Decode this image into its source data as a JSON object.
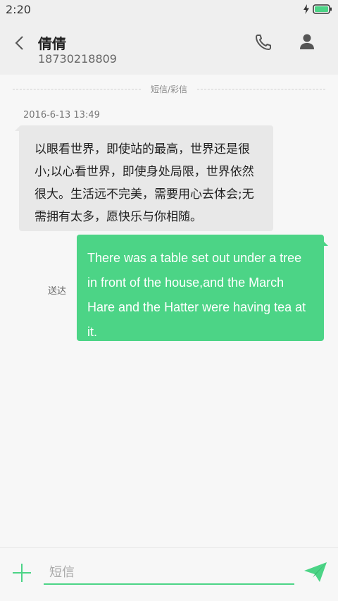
{
  "status_bar": {
    "time": "2:20"
  },
  "header": {
    "name": "倩倩",
    "number": "18730218809"
  },
  "thread": {
    "divider_label": "短信/彩信",
    "timestamp": "2016-6-13 13:49",
    "incoming_text": "以眼看世界，即使站的最高，世界还是很小;以心看世界，即使身处局限，世界依然很大。生活远不完美，需要用心去体会;无需拥有太多，愿快乐与你相随。",
    "sent_status": "送达",
    "outgoing_text": "There was a table set out under a tree in front of the house,and the March Hare and the Hatter were having tea at it."
  },
  "composer": {
    "placeholder": "短信",
    "value": ""
  },
  "colors": {
    "accent": "#4cd486",
    "incoming_bubble": "#e8e8e8",
    "background": "#f7f7f7"
  },
  "icons": {
    "back": "chevron-left-icon",
    "call": "phone-icon",
    "profile": "person-icon",
    "add": "plus-icon",
    "send": "paper-plane-icon",
    "battery": "battery-icon",
    "charging": "bolt-icon"
  }
}
